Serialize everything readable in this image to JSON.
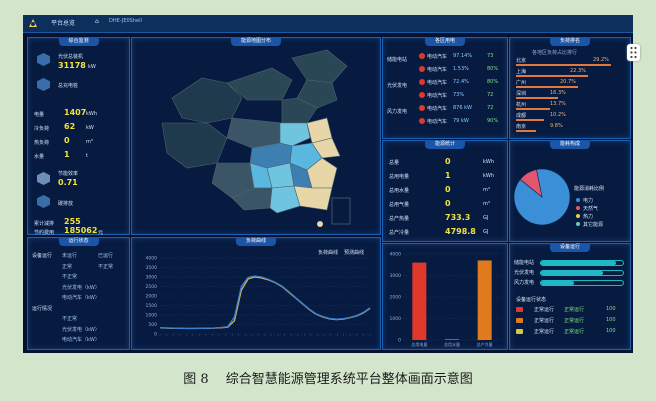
{
  "caption": "图 8　 综合智慧能源管理系统平台整体画面示意图",
  "topbar": {
    "brand": "平台总览",
    "crumb": "DHE-JE0Shell"
  },
  "panels": {
    "p1": "综合监测",
    "map": "能源地图分布",
    "p3": "各区用电",
    "p4": "负荷排名",
    "p5": "能源统计",
    "p6": "能耗构成",
    "p7": "运行状态",
    "p8": "负荷曲线",
    "p9": "设备运行"
  },
  "stats": {
    "s1_label": "光伏总装机",
    "s1_value": "31178",
    "s1_unit": "kW",
    "s2_label": "总充电桩",
    "rows": [
      {
        "label": "电量",
        "value": "1407",
        "unit": "kWh"
      },
      {
        "label": "冷负荷",
        "value": "62",
        "unit": "kW"
      },
      {
        "label": "热负荷",
        "value": "0",
        "unit": "m³"
      },
      {
        "label": "水量",
        "value": "1",
        "unit": "t"
      }
    ],
    "s3_label": "节能效率",
    "s3_value": "0.71",
    "s4_label": "碳排放",
    "bottom": [
      {
        "label": "累计减排",
        "value": "255"
      },
      {
        "label": "节约费用",
        "value": "185062",
        "unit": "元"
      }
    ]
  },
  "p3_rows": [
    {
      "group": "储能电站",
      "items": [
        {
          "tag": "电动汽车",
          "pct": "97.14%",
          "v": "73"
        },
        {
          "tag": "电动汽车",
          "pct": "1.53%",
          "v": "80%"
        }
      ]
    },
    {
      "group": "光伏发电",
      "items": [
        {
          "tag": "电动汽车",
          "pct": "72.4%",
          "v": "80%"
        },
        {
          "tag": "电动汽车",
          "pct": "73%",
          "v": "72"
        }
      ]
    },
    {
      "group": "风力发电",
      "items": [
        {
          "tag": "电动汽车",
          "pct": "876 kW",
          "v": "72"
        },
        {
          "tag": "电动汽车",
          "pct": "79 kW",
          "v": "90%"
        }
      ]
    }
  ],
  "p4_sub": "各地区负荷占比排行",
  "p4_rows": [
    {
      "name": "北京",
      "value": "29.2%",
      "frac": 0.95
    },
    {
      "name": "上海",
      "value": "22.3%",
      "frac": 0.72
    },
    {
      "name": "广州",
      "value": "20.7%",
      "frac": 0.62
    },
    {
      "name": "深圳",
      "value": "16.3%",
      "frac": 0.42
    },
    {
      "name": "杭州",
      "value": "13.7%",
      "frac": 0.34
    },
    {
      "name": "成都",
      "value": "10.2%",
      "frac": 0.28
    },
    {
      "name": "南京",
      "value": "9.8%",
      "frac": 0.2
    }
  ],
  "p5_rows": [
    {
      "label": "总量",
      "value": "0",
      "unit": "kWh"
    },
    {
      "label": "总用电量",
      "value": "1",
      "unit": "kWh"
    },
    {
      "label": "总用水量",
      "value": "0",
      "unit": "m³"
    },
    {
      "label": "总用气量",
      "value": "0",
      "unit": "m³"
    },
    {
      "label": "总产热量",
      "value": "733.3",
      "unit": "GJ"
    },
    {
      "label": "总产冷量",
      "value": "4798.8",
      "unit": "GJ"
    }
  ],
  "p6_legend_title": "能源消耗比例",
  "p6_legend": [
    {
      "name": "电力",
      "color": "#3b8fd6"
    },
    {
      "name": "天然气",
      "color": "#e2576b"
    },
    {
      "name": "热力",
      "color": "#f2c94c"
    },
    {
      "name": "其它能源",
      "color": "#5ad1b8"
    }
  ],
  "p6_data": [
    {
      "frac": 0.89,
      "color": "#3b8fd6"
    },
    {
      "frac": 0.11,
      "color": "#e2576b"
    }
  ],
  "p7_rows": [
    {
      "label": "设备运行",
      "v1": "未运行",
      "v2": "已运行"
    },
    {
      "label": "",
      "v1": "正常",
      "v2": "不正常"
    },
    {
      "label": "",
      "v1": "不正常",
      "v2": ""
    },
    {
      "label": "",
      "v1": "光伏发电（kW）",
      "v2": ""
    },
    {
      "label": "",
      "v1": "电动汽车（kW）",
      "v2": ""
    },
    {
      "label": "运行情况",
      "v1": "",
      "v2": ""
    },
    {
      "label": "",
      "v1": "不正常",
      "v2": ""
    },
    {
      "label": "",
      "v1": "光伏发电（kW）",
      "v2": ""
    },
    {
      "label": "",
      "v1": "电动汽车（kW）",
      "v2": ""
    }
  ],
  "p8_legend": [
    "负荷曲线",
    "预测曲线"
  ],
  "p8_yticks": [
    "4000",
    "3500",
    "3000",
    "2500",
    "2000",
    "1500",
    "1000",
    "500",
    "0"
  ],
  "chart_data": {
    "type": "line",
    "series": [
      {
        "name": "负荷曲线",
        "values": [
          320,
          310,
          300,
          295,
          290,
          292,
          295,
          300,
          310,
          330,
          360,
          700,
          2300,
          2900,
          3000,
          2950,
          2850,
          2700,
          2500,
          2200,
          1900,
          1600,
          1300,
          1050,
          900,
          800,
          760,
          780,
          850,
          950,
          1100,
          1350
        ],
        "color": "#d7b25a"
      },
      {
        "name": "预测曲线",
        "values": [
          330,
          320,
          305,
          298,
          293,
          295,
          298,
          305,
          315,
          340,
          380,
          900,
          2500,
          2980,
          3050,
          3000,
          2880,
          2720,
          2520,
          2230,
          1920,
          1620,
          1320,
          1070,
          920,
          820,
          780,
          800,
          870,
          970,
          1130,
          1380
        ],
        "color": "#3a7fd0"
      }
    ],
    "ylim": [
      0,
      4000
    ]
  },
  "p9_bars": [
    {
      "label": "储能电站",
      "frac": 0.92
    },
    {
      "label": "光伏发电",
      "frac": 0.75
    },
    {
      "label": "风力发电",
      "frac": 0.4
    }
  ],
  "p9_sub": "设备运行状态",
  "p9_rows": [
    {
      "tag": "正常运行",
      "state": "正常运行",
      "v": "100"
    },
    {
      "tag": "正常运行",
      "state": "正常运行",
      "v": "100"
    },
    {
      "tag": "正常运行",
      "state": "正常运行",
      "v": "100"
    }
  ],
  "p9_colors": [
    "#e0392b",
    "#e07a1f",
    "#d8c84a"
  ],
  "bar_data": {
    "type": "bar",
    "values": [
      3600,
      50,
      3700
    ],
    "colors": [
      "#e0392b",
      "#2b6fd0",
      "#e07a1f"
    ],
    "labels": [
      "总用电量",
      "总用水量",
      "总产冷量"
    ],
    "yticks": [
      "4000",
      "3000",
      "2000",
      "1000",
      "0"
    ],
    "ylim": [
      0,
      4000
    ]
  }
}
